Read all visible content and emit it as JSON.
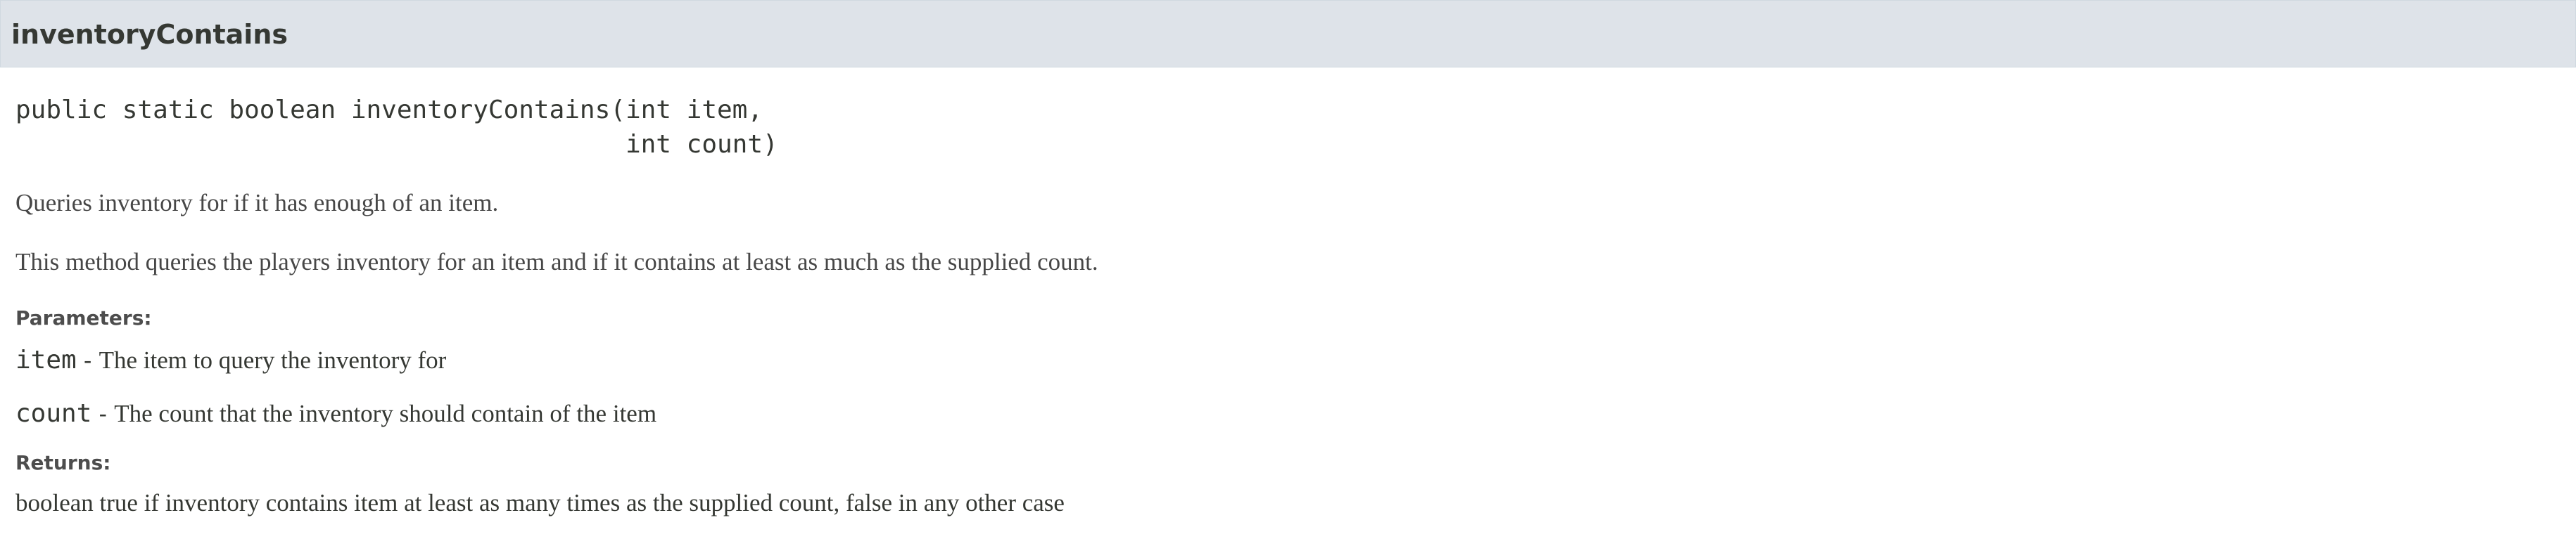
{
  "method": {
    "name": "inventoryContains",
    "signature": "public static boolean inventoryContains(int item,\n                                        int count)",
    "summary": "Queries inventory for if it has enough of an item.",
    "description": "This method queries the players inventory for an item and if it contains at least as much as the supplied count.",
    "parameters_label": "Parameters:",
    "parameters": [
      {
        "name": "item",
        "separator": " - ",
        "description": "The item to query the inventory for"
      },
      {
        "name": "count",
        "separator": " - ",
        "description": "The count that the inventory should contain of the item"
      }
    ],
    "returns_label": "Returns:",
    "returns": "boolean true if inventory contains item at least as many times as the supplied count, false in any other case"
  }
}
